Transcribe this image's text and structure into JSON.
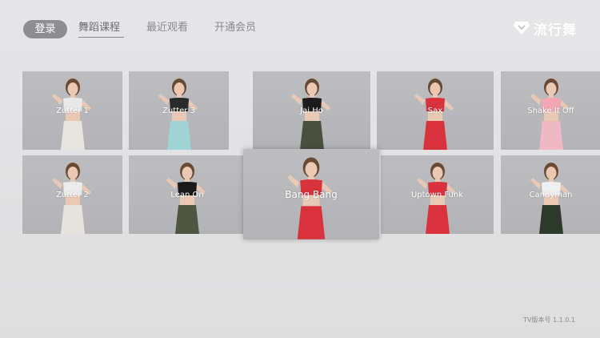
{
  "header": {
    "login_label": "登录",
    "nav": [
      {
        "label": "舞蹈课程",
        "active": true
      },
      {
        "label": "最近观看",
        "active": false
      },
      {
        "label": "开通会员",
        "active": false
      }
    ],
    "logo_text": "流行舞",
    "logo_icon": "diamond-heart-icon"
  },
  "courses": {
    "row1": [
      {
        "title": "Zutter 1",
        "top_color": "#e8e8e8",
        "bottom_color": "#e8e4e0"
      },
      {
        "title": "Zutter 3",
        "top_color": "#2a2a2a",
        "bottom_color": "#9fd4d6"
      },
      {
        "title": "Jai Ho",
        "top_color": "#1c1c1c",
        "bottom_color": "#4a5040"
      },
      {
        "title": "Sax",
        "top_color": "#d8323c",
        "bottom_color": "#d8323c"
      },
      {
        "title": "Shake It Off",
        "top_color": "#f2a6b4",
        "bottom_color": "#f0b8c4"
      }
    ],
    "row2": [
      {
        "title": "Zutter 2",
        "top_color": "#ececec",
        "bottom_color": "#e6e2de"
      },
      {
        "title": "Lean On",
        "top_color": "#1a1a1a",
        "bottom_color": "#4e5642"
      },
      {
        "title": "Bang Bang",
        "top_color": "#d8323c",
        "bottom_color": "#d8323c",
        "focused": true
      },
      {
        "title": "Uptown Funk",
        "top_color": "#d8323c",
        "bottom_color": "#d8323c"
      },
      {
        "title": "Candyman",
        "top_color": "#f0f0f0",
        "bottom_color": "#2c3a2c"
      }
    ]
  },
  "footer": {
    "version_text": "TV版本号 1.1.0.1"
  },
  "colors": {
    "background": "#e4e4e6",
    "login_button": "#8e8e92",
    "nav_text": "#8a8a8e",
    "card_background": "#b8b8ba"
  }
}
